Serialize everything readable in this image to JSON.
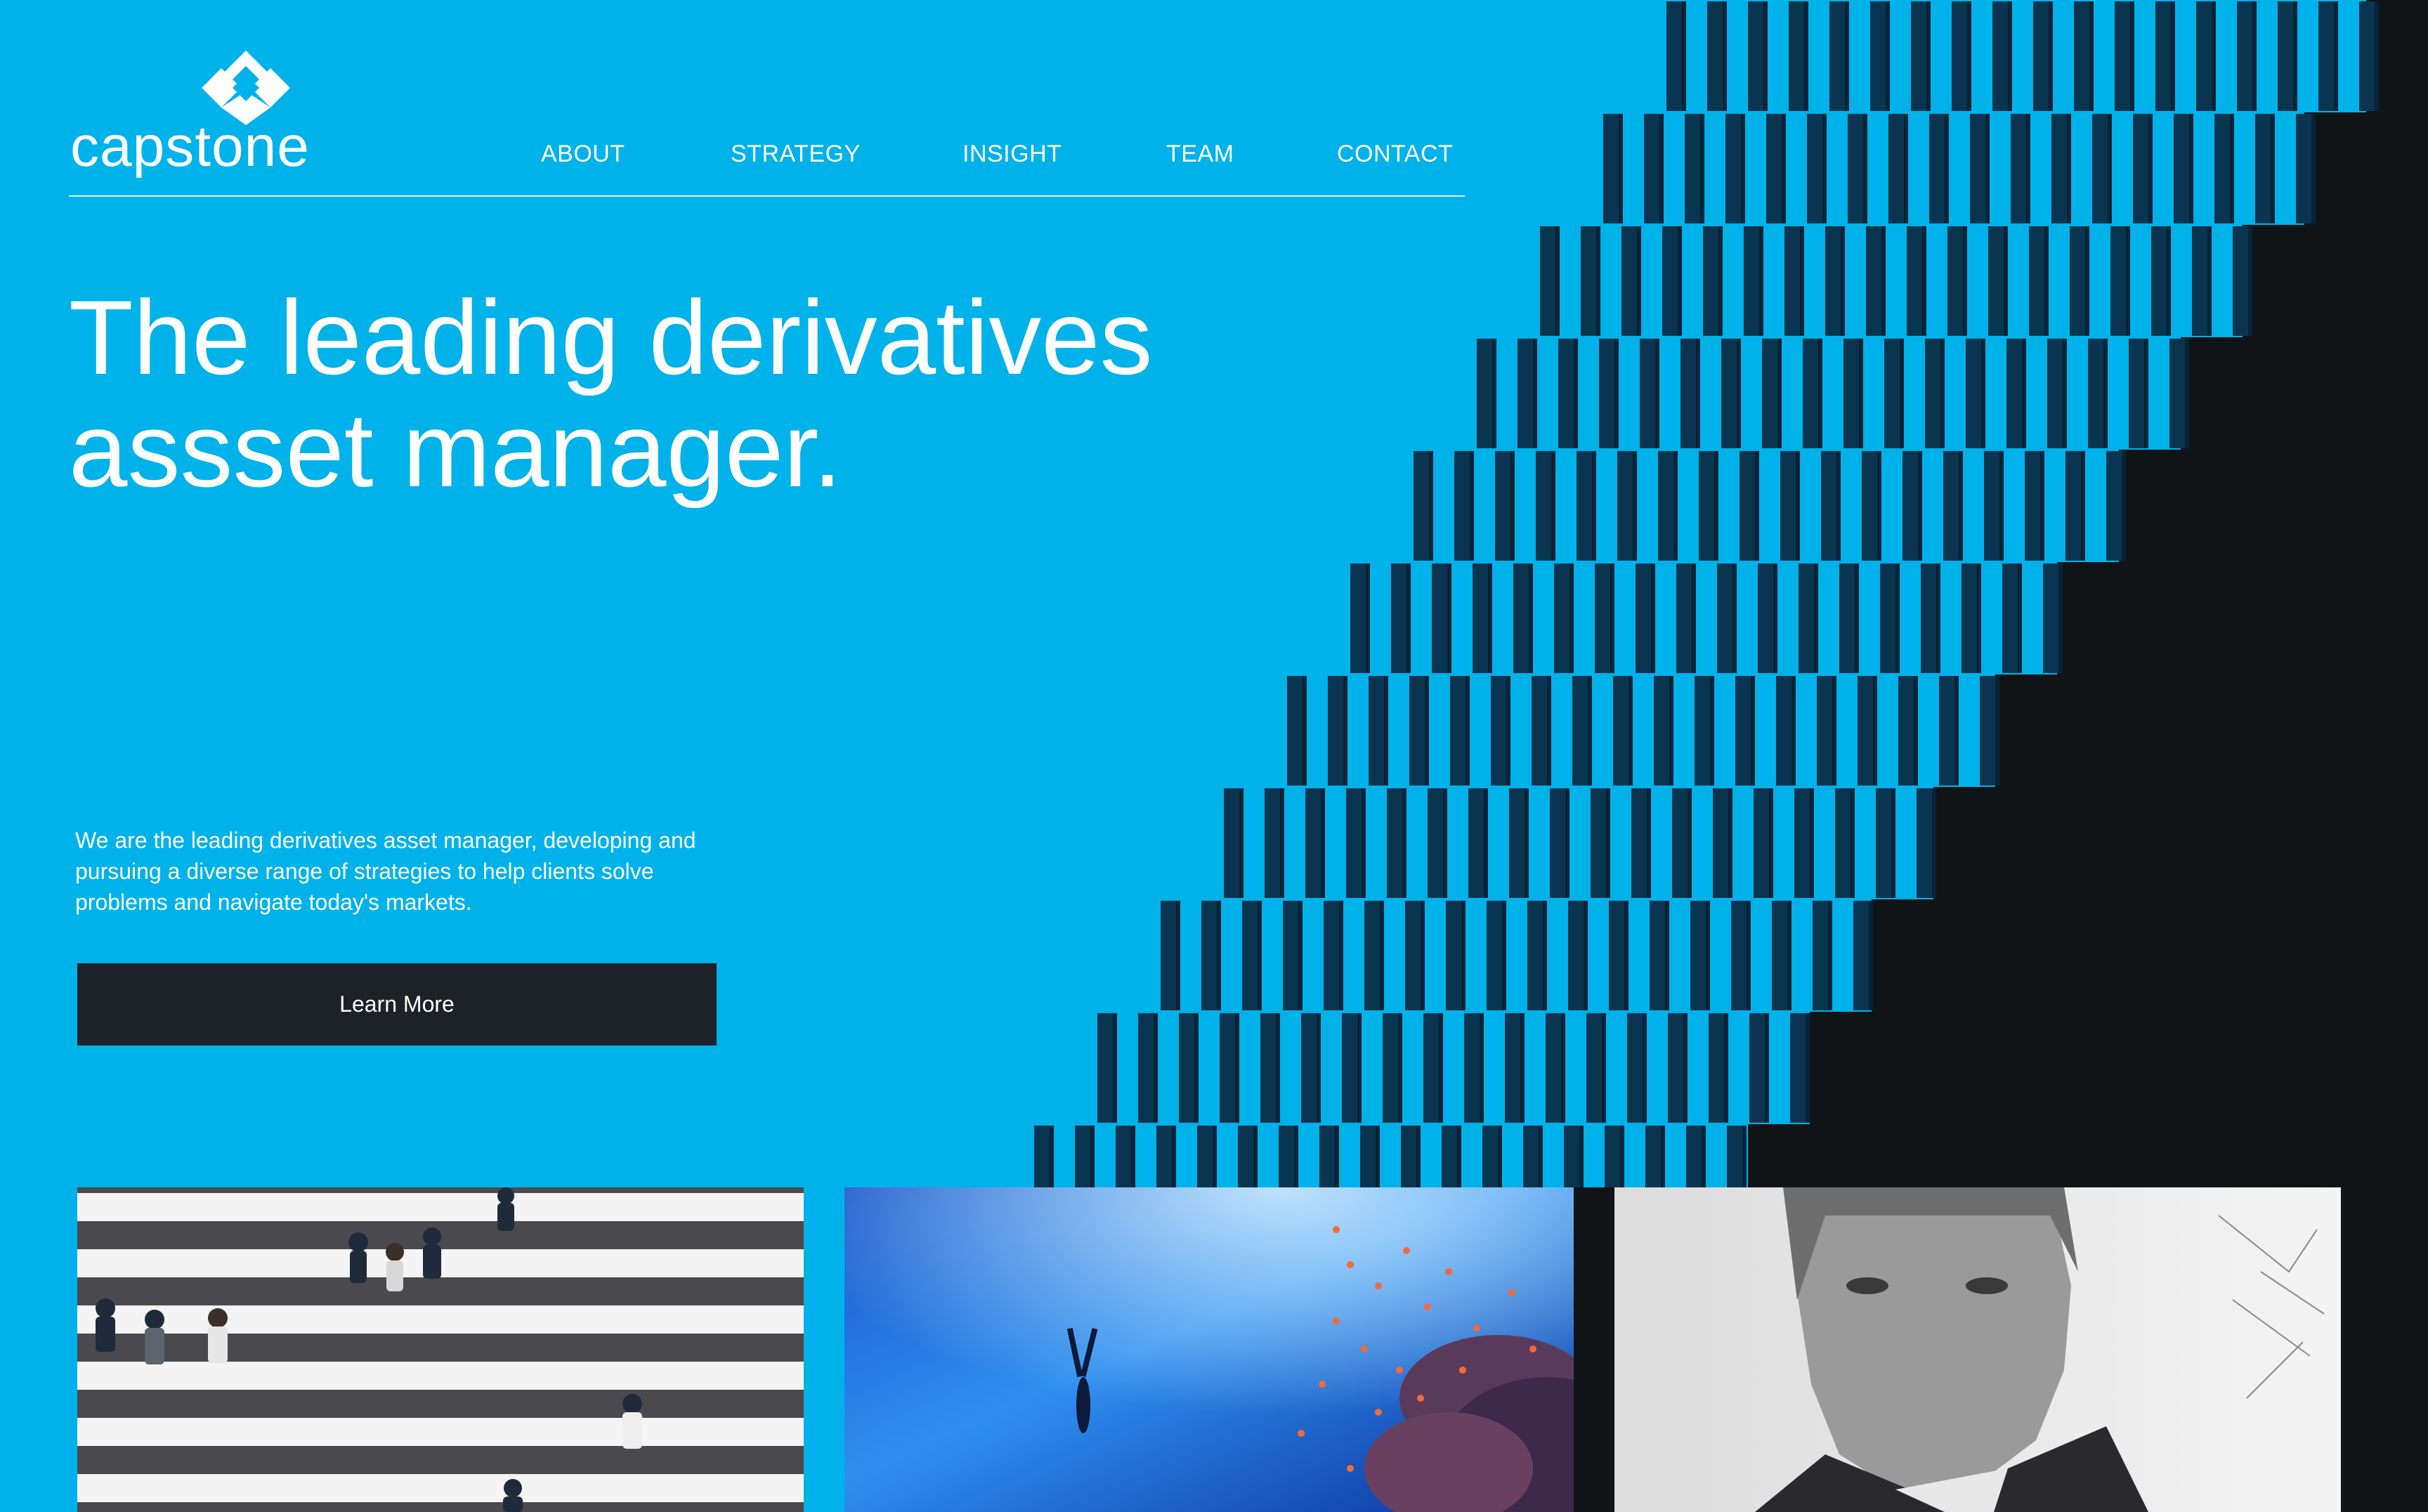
{
  "brand": {
    "name": "capstone",
    "logo_icon": "diamond-logo-icon",
    "colors": {
      "background": "#00b2ea",
      "dark": "#111417",
      "button": "#1c2227",
      "stripe": "#0a3550"
    }
  },
  "nav": {
    "items": [
      {
        "label": "ABOUT"
      },
      {
        "label": "STRATEGY"
      },
      {
        "label": "INSIGHT"
      },
      {
        "label": "TEAM"
      },
      {
        "label": "CONTACT"
      }
    ]
  },
  "hero": {
    "headline_line1": "The leading derivatives",
    "headline_line2": "assset manager.",
    "intro": "We are the leading derivatives asset manager, developing and pursuing a diverse range of strategies to help clients solve problems and navigate today's markets.",
    "cta_label": "Learn More"
  },
  "cards": [
    {
      "image": "pedestrian-crossing-photo"
    },
    {
      "image": "underwater-diver-photo"
    },
    {
      "image": "portrait-photo"
    }
  ]
}
